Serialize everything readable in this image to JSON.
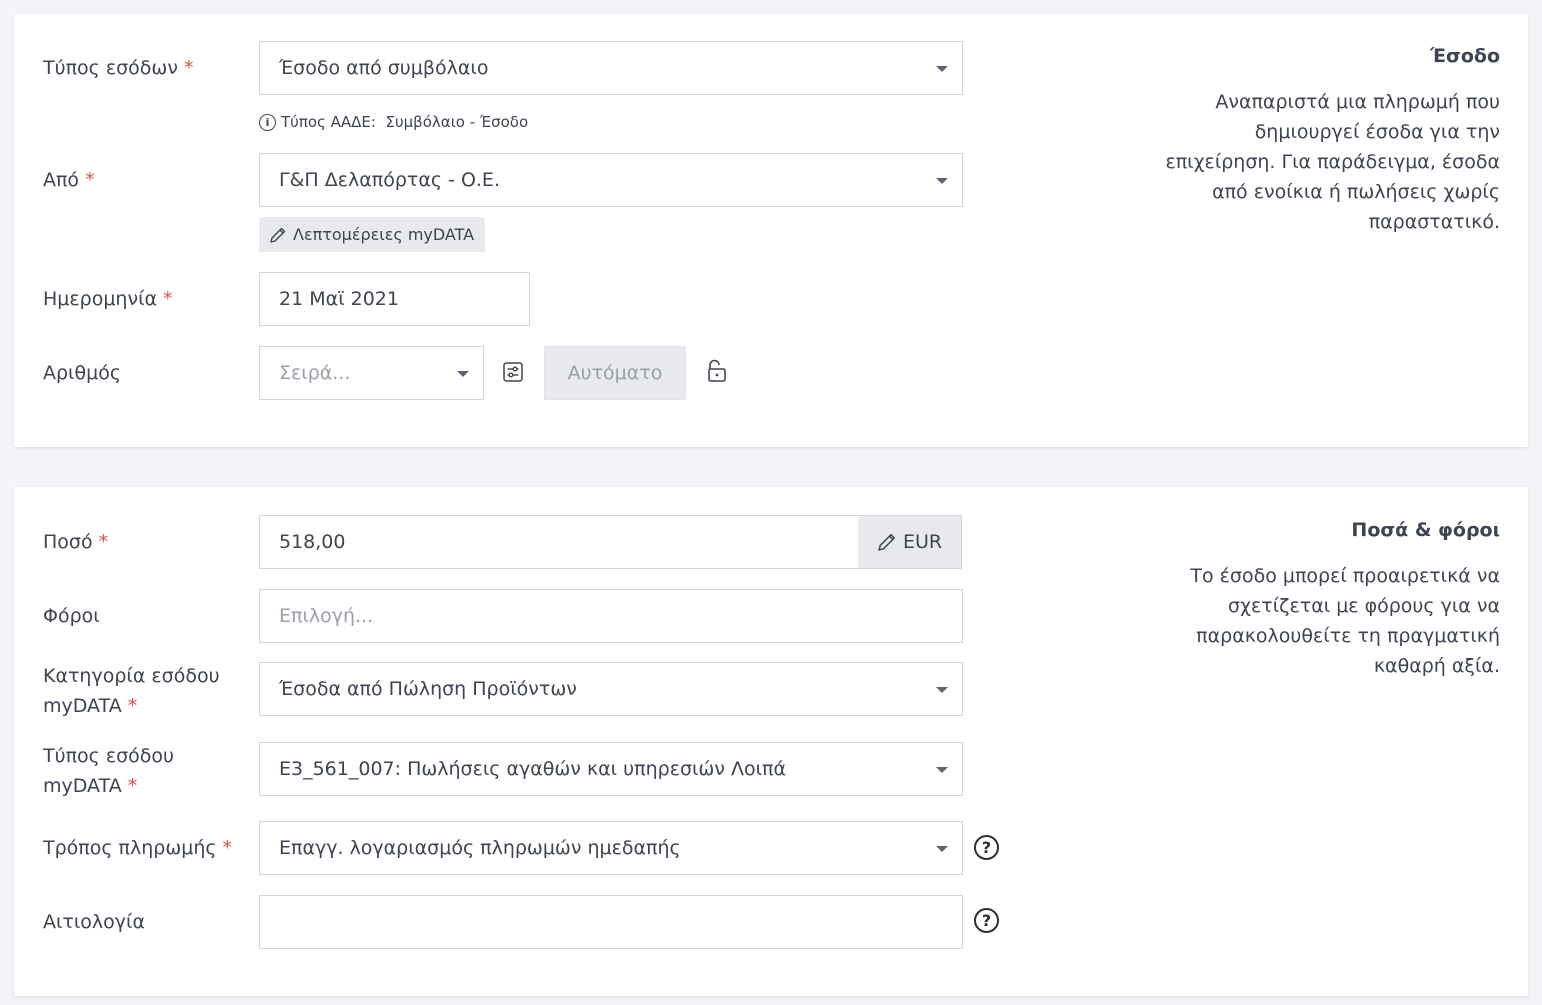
{
  "income_section": {
    "income_type": {
      "label": "Τύπος εσόδων",
      "required_mark": "*",
      "value": "Έσοδο από συμβόλαιο"
    },
    "aade_hint": {
      "icon": "info-icon",
      "prefix": "Τύπος ΑΑΔΕ:",
      "value": "Συμβόλαιο - Έσοδο"
    },
    "from": {
      "label": "Από",
      "required_mark": "*",
      "value": "Γ&Π Δελαπόρτας - Ο.Ε."
    },
    "mydata_button": {
      "icon": "pencil-icon",
      "label": "Λεπτομέρειες myDATA"
    },
    "date": {
      "label": "Ημερομηνία",
      "required_mark": "*",
      "value": "21 Μαϊ 2021"
    },
    "number": {
      "label": "Αριθμός",
      "series_placeholder": "Σειρά...",
      "settings_icon": "sliders-icon",
      "auto_placeholder": "Αυτόματο",
      "lock_icon": "unlock-icon"
    },
    "side": {
      "title": "Έσοδο",
      "lines": [
        "Αναπαριστά μια πληρωμή που",
        "δημιουργεί έσοδα για την",
        "επιχείρηση. Για παράδειγμα, έσοδα",
        "από ενοίκια ή πωλήσεις χωρίς",
        "παραστατικό."
      ]
    }
  },
  "amounts_section": {
    "amount": {
      "label": "Ποσό",
      "required_mark": "*",
      "value": "518,00",
      "currency": "EUR",
      "currency_icon": "pencil-icon"
    },
    "taxes": {
      "label": "Φόροι",
      "placeholder": "Επιλογή..."
    },
    "category": {
      "label_line1": "Κατηγορία εσόδου",
      "label_line2": "myDATA",
      "required_mark": "*",
      "value": "Έσοδα από Πώληση Προϊόντων"
    },
    "mydata_type": {
      "label_line1": "Τύπος εσόδου",
      "label_line2": "myDATA",
      "required_mark": "*",
      "value": "Ε3_561_007: Πωλήσεις αγαθών και υπηρεσιών Λοιπά"
    },
    "payment_method": {
      "label": "Τρόπος πληρωμής",
      "required_mark": "*",
      "value": "Επαγγ. λογαριασμός πληρωμών ημεδαπής",
      "help": "?"
    },
    "reason": {
      "label": "Αιτιολογία",
      "value": "",
      "help": "?"
    },
    "side": {
      "title": "Ποσά & φόροι",
      "lines": [
        "Το έσοδο μπορεί προαιρετικά να",
        "σχετίζεται με φόρους για να",
        "παρακολουθείτε τη πραγματική",
        "καθαρή αξία."
      ]
    }
  }
}
